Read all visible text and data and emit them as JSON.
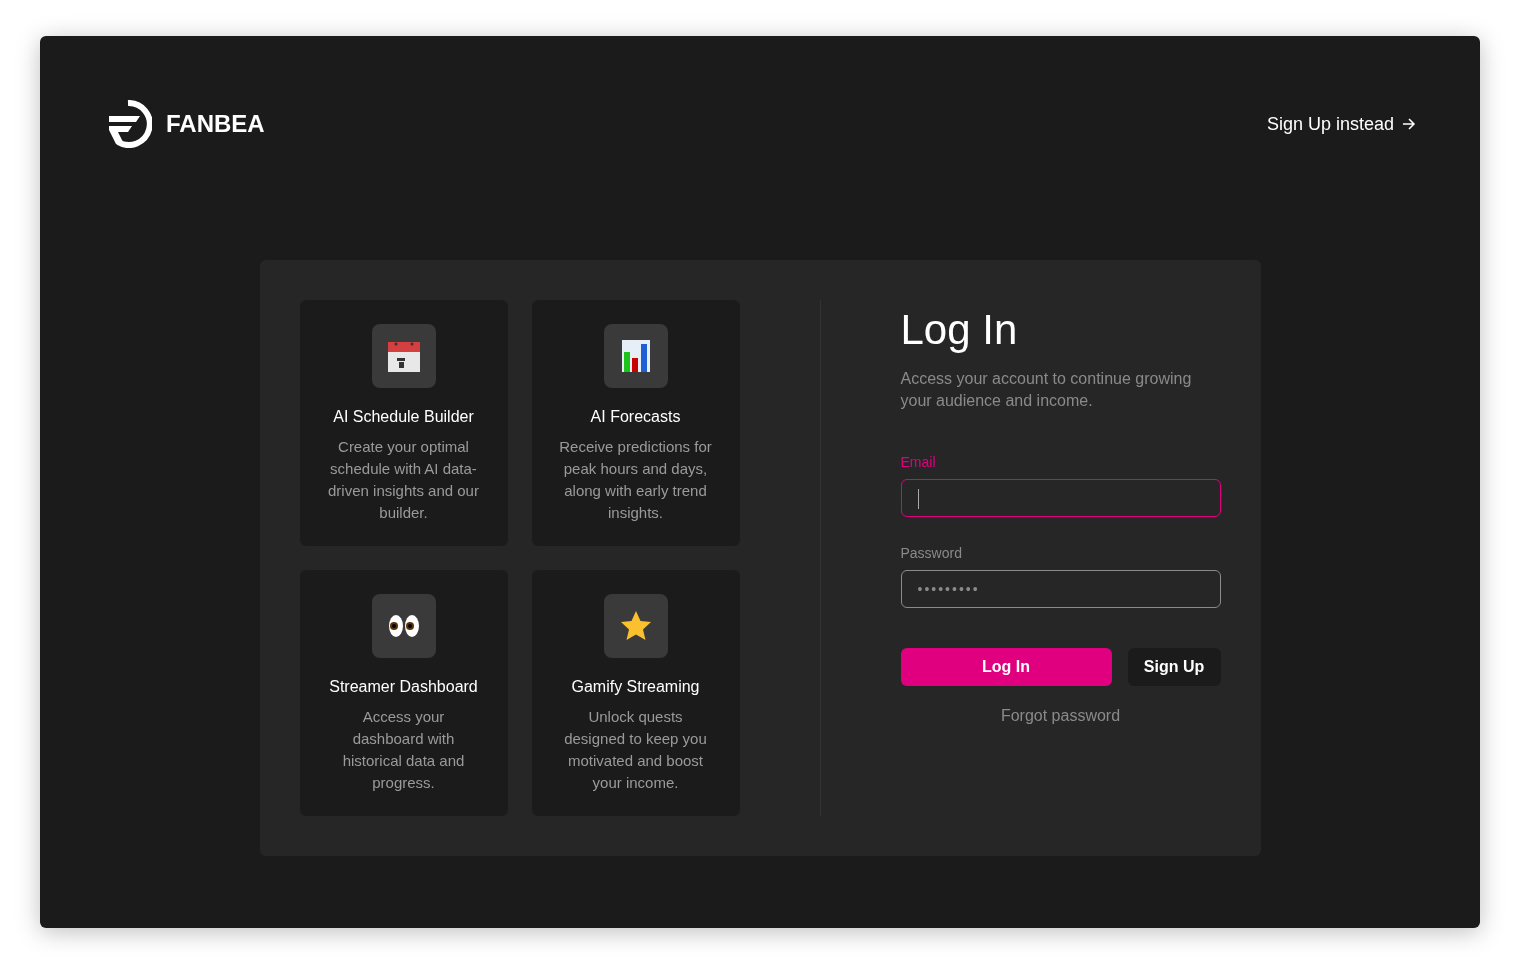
{
  "brand": {
    "name": "FANBEA"
  },
  "header_link": {
    "label": "Sign Up instead"
  },
  "features": [
    {
      "kind": "calendar",
      "title": "AI Schedule Builder",
      "description": "Create your optimal schedule with AI data-driven insights and our builder."
    },
    {
      "kind": "chart",
      "title": "AI Forecasts",
      "description": "Receive predictions for peak hours and days, along with early trend insights."
    },
    {
      "kind": "eyes",
      "title": "Streamer Dashboard",
      "description": "Access your dashboard with historical data and progress."
    },
    {
      "kind": "star",
      "title": "Gamify Streaming",
      "description": "Unlock quests designed to keep you motivated and boost your income."
    }
  ],
  "login": {
    "title": "Log In",
    "subtitle": "Access your account to continue growing your audience and income.",
    "fields": [
      {
        "label": "Email",
        "focused": true
      },
      {
        "label": "Password",
        "value": "•••••••••",
        "focused": false
      }
    ],
    "buttons": [
      {
        "label": "Log In",
        "kind": "primary"
      },
      {
        "label": "Sign Up",
        "kind": "secondary"
      }
    ],
    "forgot": "Forgot password"
  }
}
